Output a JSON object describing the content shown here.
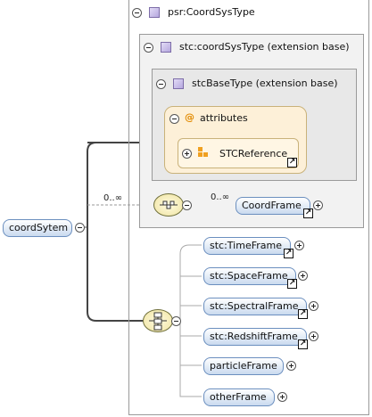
{
  "schema": {
    "root_type": "psr:CoordSysType",
    "ext1": "stc:coordSysType (extension base)",
    "ext2": "stcBaseType (extension base)",
    "attributes_label": "attributes",
    "attr_item": "STCReference",
    "element": "coordSytem",
    "occurs_seq": "0..∞",
    "occurs_item": "0..∞",
    "coordframe": "CoordFrame",
    "choices": [
      {
        "label": "stc:TimeFrame",
        "link": true
      },
      {
        "label": "stc:SpaceFrame",
        "link": true
      },
      {
        "label": "stc:SpectralFrame",
        "link": true
      },
      {
        "label": "stc:RedshiftFrame",
        "link": true
      },
      {
        "label": "particleFrame",
        "link": false
      },
      {
        "label": "otherFrame",
        "link": false
      }
    ]
  },
  "colors": {
    "outer_border": "#9a9a9a",
    "inner_fill": "#f0f0f0",
    "attr_fill": "#fdf0d8",
    "pill_border": "#6b8fbf"
  },
  "icons": [
    "type-icon",
    "attribute-at-icon",
    "attribute-group-icon",
    "link-arrow-icon",
    "sequence-compositor-icon",
    "choice-compositor-icon",
    "collapse-icon",
    "expand-icon"
  ]
}
